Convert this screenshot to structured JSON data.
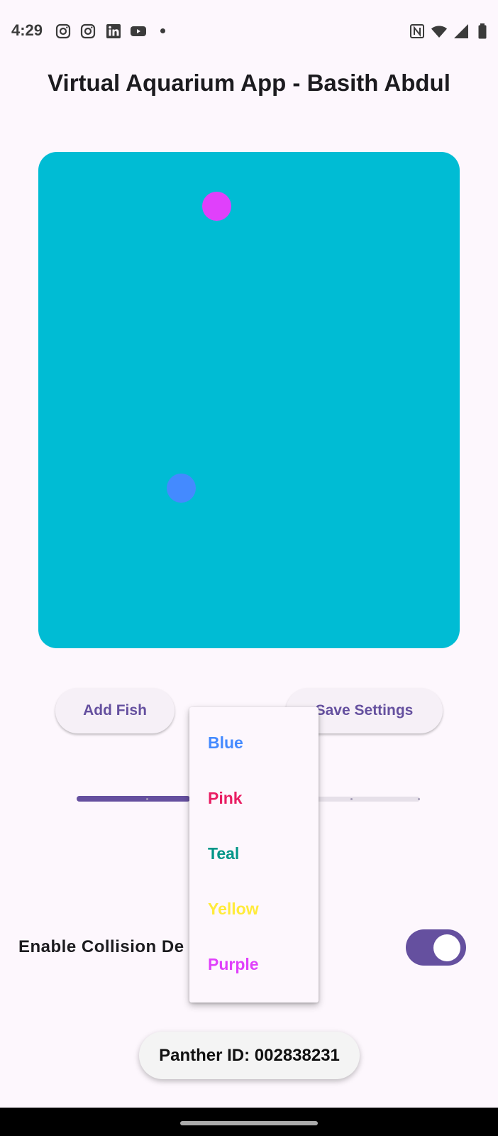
{
  "status_bar": {
    "time": "4:29",
    "left_icons": [
      "instagram-icon",
      "instagram-icon",
      "linkedin-icon",
      "youtube-icon",
      "dot-icon"
    ],
    "right_icons": [
      "nfc-icon",
      "wifi-icon",
      "signal-icon",
      "battery-icon"
    ]
  },
  "header": {
    "title": "Virtual Aquarium App - Basith Abdul"
  },
  "aquarium": {
    "background_color": "#00bcd4",
    "fish": [
      {
        "color": "#e040fb"
      },
      {
        "color": "#448aff"
      }
    ]
  },
  "buttons": {
    "add_fish": "Add Fish",
    "save_settings": "Save Settings"
  },
  "slider": {
    "value_fraction": 0.33,
    "fill_color": "#65509f",
    "track_color": "#e6e0e9"
  },
  "settings": {
    "collision_label": "Enable Collision De",
    "collision_enabled": true
  },
  "dropdown": {
    "items": [
      {
        "label": "Blue",
        "color": "#448aff"
      },
      {
        "label": "Pink",
        "color": "#e91e63"
      },
      {
        "label": "Teal",
        "color": "#009688"
      },
      {
        "label": "Yellow",
        "color": "#ffeb3b"
      },
      {
        "label": "Purple",
        "color": "#e040fb"
      }
    ]
  },
  "footer": {
    "panther_id": "Panther ID: 002838231"
  },
  "colors": {
    "accent": "#65509f",
    "page_background": "#fdf7fd"
  }
}
